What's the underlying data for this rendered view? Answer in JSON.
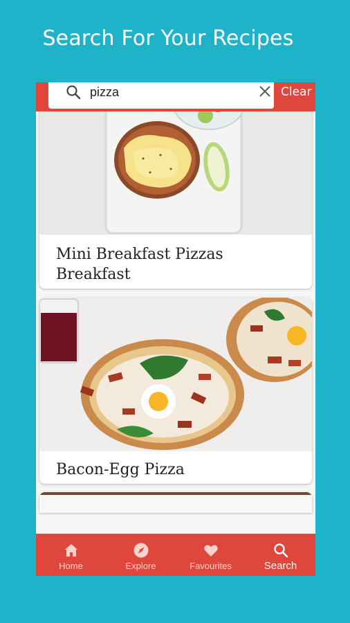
{
  "promo": {
    "title": "Search For Your Recipes"
  },
  "search": {
    "value": "pizza",
    "clear_label": "Clear"
  },
  "results": [
    {
      "title": "Mini Breakfast Pizzas Breakfast"
    },
    {
      "title": "Bacon-Egg Pizza"
    }
  ],
  "nav": {
    "items": [
      {
        "label": "Home",
        "icon": "home-icon"
      },
      {
        "label": "Explore",
        "icon": "compass-icon"
      },
      {
        "label": "Favourites",
        "icon": "heart-icon"
      },
      {
        "label": "Search",
        "icon": "search-icon",
        "active": true
      }
    ]
  },
  "colors": {
    "background": "#1fb3c9",
    "accent": "#e0473c"
  }
}
